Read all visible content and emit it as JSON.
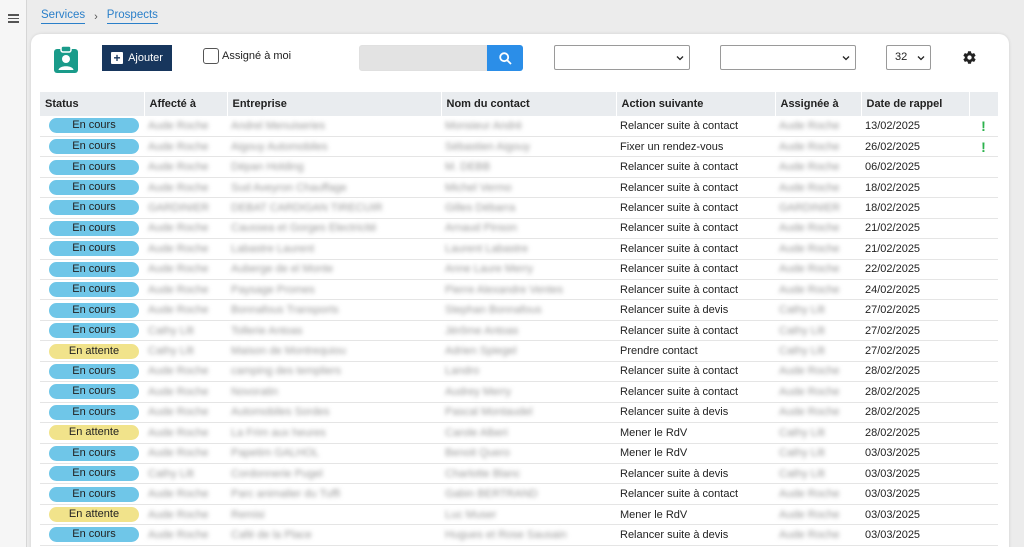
{
  "breadcrumb": [
    "Services",
    "Prospects"
  ],
  "toolbar": {
    "add_label": "Ajouter",
    "assign_label": "Assigné à moi",
    "search_placeholder": "",
    "filter1": "",
    "filter2": "",
    "page_size": "32"
  },
  "colors": {
    "accent": "#17365d",
    "search": "#2b8ee8",
    "en_cours": "#6fc6e8",
    "en_attente": "#f1e38b",
    "flag": "#2bb24c"
  },
  "columns": [
    "Status",
    "Affecté à",
    "Entreprise",
    "Nom du contact",
    "Action suivante",
    "Assignée à",
    "Date de rappel",
    ""
  ],
  "rows": [
    {
      "status": "En cours",
      "type": "cours",
      "affecte": "Aude Roche",
      "entreprise": "Andrel Menuiseries",
      "contact": "Monsieur André",
      "action": "Relancer suite à contact",
      "assignee": "Aude Roche",
      "date": "13/02/2025",
      "flag": "!"
    },
    {
      "status": "En cours",
      "type": "cours",
      "affecte": "Aude Roche",
      "entreprise": "Aigouy Automobiles",
      "contact": "Sébastien Aigouy",
      "action": "Fixer un rendez-vous",
      "assignee": "Aude Roche",
      "date": "26/02/2025",
      "flag": "!"
    },
    {
      "status": "En cours",
      "type": "cours",
      "affecte": "Aude Roche",
      "entreprise": "Dépan Holding",
      "contact": "M. DEBB",
      "action": "Relancer suite à contact",
      "assignee": "Aude Roche",
      "date": "06/02/2025",
      "flag": ""
    },
    {
      "status": "En cours",
      "type": "cours",
      "affecte": "Aude Roche",
      "entreprise": "Sud Aveyron Chauffage",
      "contact": "Michel Vermo",
      "action": "Relancer suite à contact",
      "assignee": "Aude Roche",
      "date": "18/02/2025",
      "flag": ""
    },
    {
      "status": "En cours",
      "type": "cours",
      "affecte": "GARDINIER",
      "entreprise": "DEBAT CARDIGAN TIRECUIR",
      "contact": "Gilles Débarra",
      "action": "Relancer suite à contact",
      "assignee": "GARDINIER",
      "date": "18/02/2025",
      "flag": ""
    },
    {
      "status": "En cours",
      "type": "cours",
      "affecte": "Aude Roche",
      "entreprise": "Caussea et Gorges Electricité",
      "contact": "Arnaud Pinson",
      "action": "Relancer suite à contact",
      "assignee": "Aude Roche",
      "date": "21/02/2025",
      "flag": ""
    },
    {
      "status": "En cours",
      "type": "cours",
      "affecte": "Aude Roche",
      "entreprise": "Labastre Laurent",
      "contact": "Laurent Labastre",
      "action": "Relancer suite à contact",
      "assignee": "Aude Roche",
      "date": "21/02/2025",
      "flag": ""
    },
    {
      "status": "En cours",
      "type": "cours",
      "affecte": "Aude Roche",
      "entreprise": "Auberge de el Monte",
      "contact": "Anne Laure Merry",
      "action": "Relancer suite à contact",
      "assignee": "Aude Roche",
      "date": "22/02/2025",
      "flag": ""
    },
    {
      "status": "En cours",
      "type": "cours",
      "affecte": "Aude Roche",
      "entreprise": "Paysage Promes",
      "contact": "Pierre Alexandre Ventes",
      "action": "Relancer suite à contact",
      "assignee": "Aude Roche",
      "date": "24/02/2025",
      "flag": ""
    },
    {
      "status": "En cours",
      "type": "cours",
      "affecte": "Aude Roche",
      "entreprise": "Bonnafous Transports",
      "contact": "Stephan Bonnafous",
      "action": "Relancer suite à devis",
      "assignee": "Cathy Lilt",
      "date": "27/02/2025",
      "flag": ""
    },
    {
      "status": "En cours",
      "type": "cours",
      "affecte": "Cathy Lilt",
      "entreprise": "Tollerie Antoas",
      "contact": "Jérôme Antoas",
      "action": "Relancer suite à contact",
      "assignee": "Cathy Lilt",
      "date": "27/02/2025",
      "flag": ""
    },
    {
      "status": "En attente",
      "type": "attente",
      "affecte": "Cathy Lilt",
      "entreprise": "Maison de Montrequiou",
      "contact": "Adrien Spiegel",
      "action": "Prendre contact",
      "assignee": "Cathy Lilt",
      "date": "27/02/2025",
      "flag": ""
    },
    {
      "status": "En cours",
      "type": "cours",
      "affecte": "Aude Roche",
      "entreprise": "camping des templiers",
      "contact": "Landro",
      "action": "Relancer suite à contact",
      "assignee": "Aude Roche",
      "date": "28/02/2025",
      "flag": ""
    },
    {
      "status": "En cours",
      "type": "cours",
      "affecte": "Aude Roche",
      "entreprise": "Novoratin",
      "contact": "Audrey Merry",
      "action": "Relancer suite à contact",
      "assignee": "Aude Roche",
      "date": "28/02/2025",
      "flag": ""
    },
    {
      "status": "En cours",
      "type": "cours",
      "affecte": "Aude Roche",
      "entreprise": "Automobiles Sordes",
      "contact": "Pascal Montaudel",
      "action": "Relancer suite à devis",
      "assignee": "Aude Roche",
      "date": "28/02/2025",
      "flag": ""
    },
    {
      "status": "En attente",
      "type": "attente",
      "affecte": "Aude Roche",
      "entreprise": "La Frim aux heures",
      "contact": "Carole Alberi",
      "action": "Mener le RdV",
      "assignee": "Cathy Lilt",
      "date": "28/02/2025",
      "flag": ""
    },
    {
      "status": "En cours",
      "type": "cours",
      "affecte": "Aude Roche",
      "entreprise": "Papetim GALHOL",
      "contact": "Benoit Quero",
      "action": "Mener le RdV",
      "assignee": "Cathy Lilt",
      "date": "03/03/2025",
      "flag": ""
    },
    {
      "status": "En cours",
      "type": "cours",
      "affecte": "Cathy Lilt",
      "entreprise": "Cordonnerie Pugel",
      "contact": "Charlotte Blanc",
      "action": "Relancer suite à devis",
      "assignee": "Cathy Lilt",
      "date": "03/03/2025",
      "flag": ""
    },
    {
      "status": "En cours",
      "type": "cours",
      "affecte": "Aude Roche",
      "entreprise": "Parc animalier du Tuffi",
      "contact": "Gabin BERTRAND",
      "action": "Relancer suite à contact",
      "assignee": "Aude Roche",
      "date": "03/03/2025",
      "flag": ""
    },
    {
      "status": "En attente",
      "type": "attente",
      "affecte": "Aude Roche",
      "entreprise": "Remisi",
      "contact": "Luc Muser",
      "action": "Mener le RdV",
      "assignee": "Aude Roche",
      "date": "03/03/2025",
      "flag": ""
    },
    {
      "status": "En cours",
      "type": "cours",
      "affecte": "Aude Roche",
      "entreprise": "Café de la Place",
      "contact": "Hugues et Rose Sausain",
      "action": "Relancer suite à devis",
      "assignee": "Aude Roche",
      "date": "03/03/2025",
      "flag": ""
    }
  ]
}
